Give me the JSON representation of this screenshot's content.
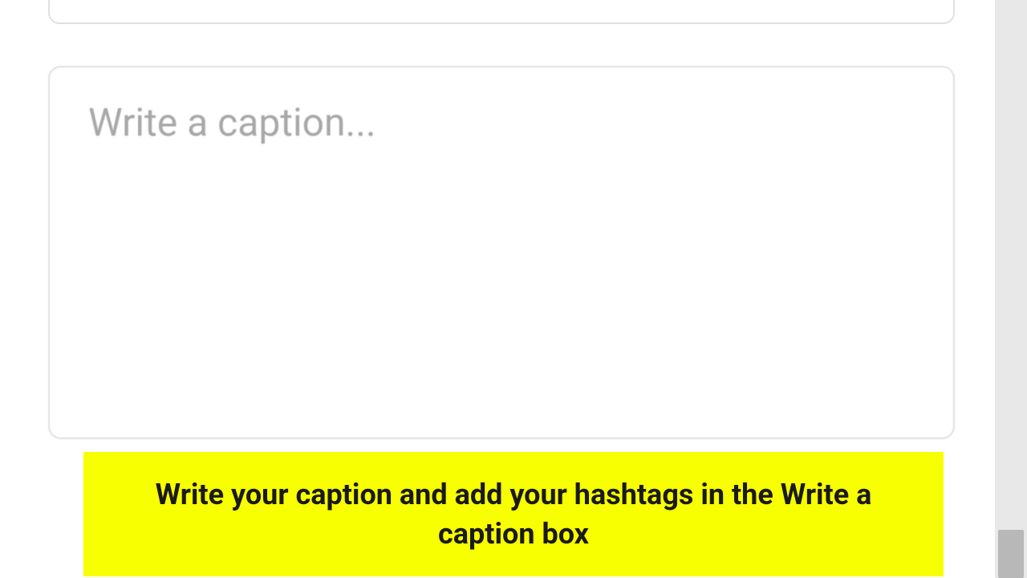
{
  "caption_input": {
    "placeholder": "Write a caption...",
    "value": ""
  },
  "instruction": {
    "text": "Write your caption and add your hashtags in the Write a caption box"
  },
  "colors": {
    "banner_bg": "#f8ff00",
    "border": "#e0e0e0",
    "placeholder": "#a8a8a8"
  }
}
